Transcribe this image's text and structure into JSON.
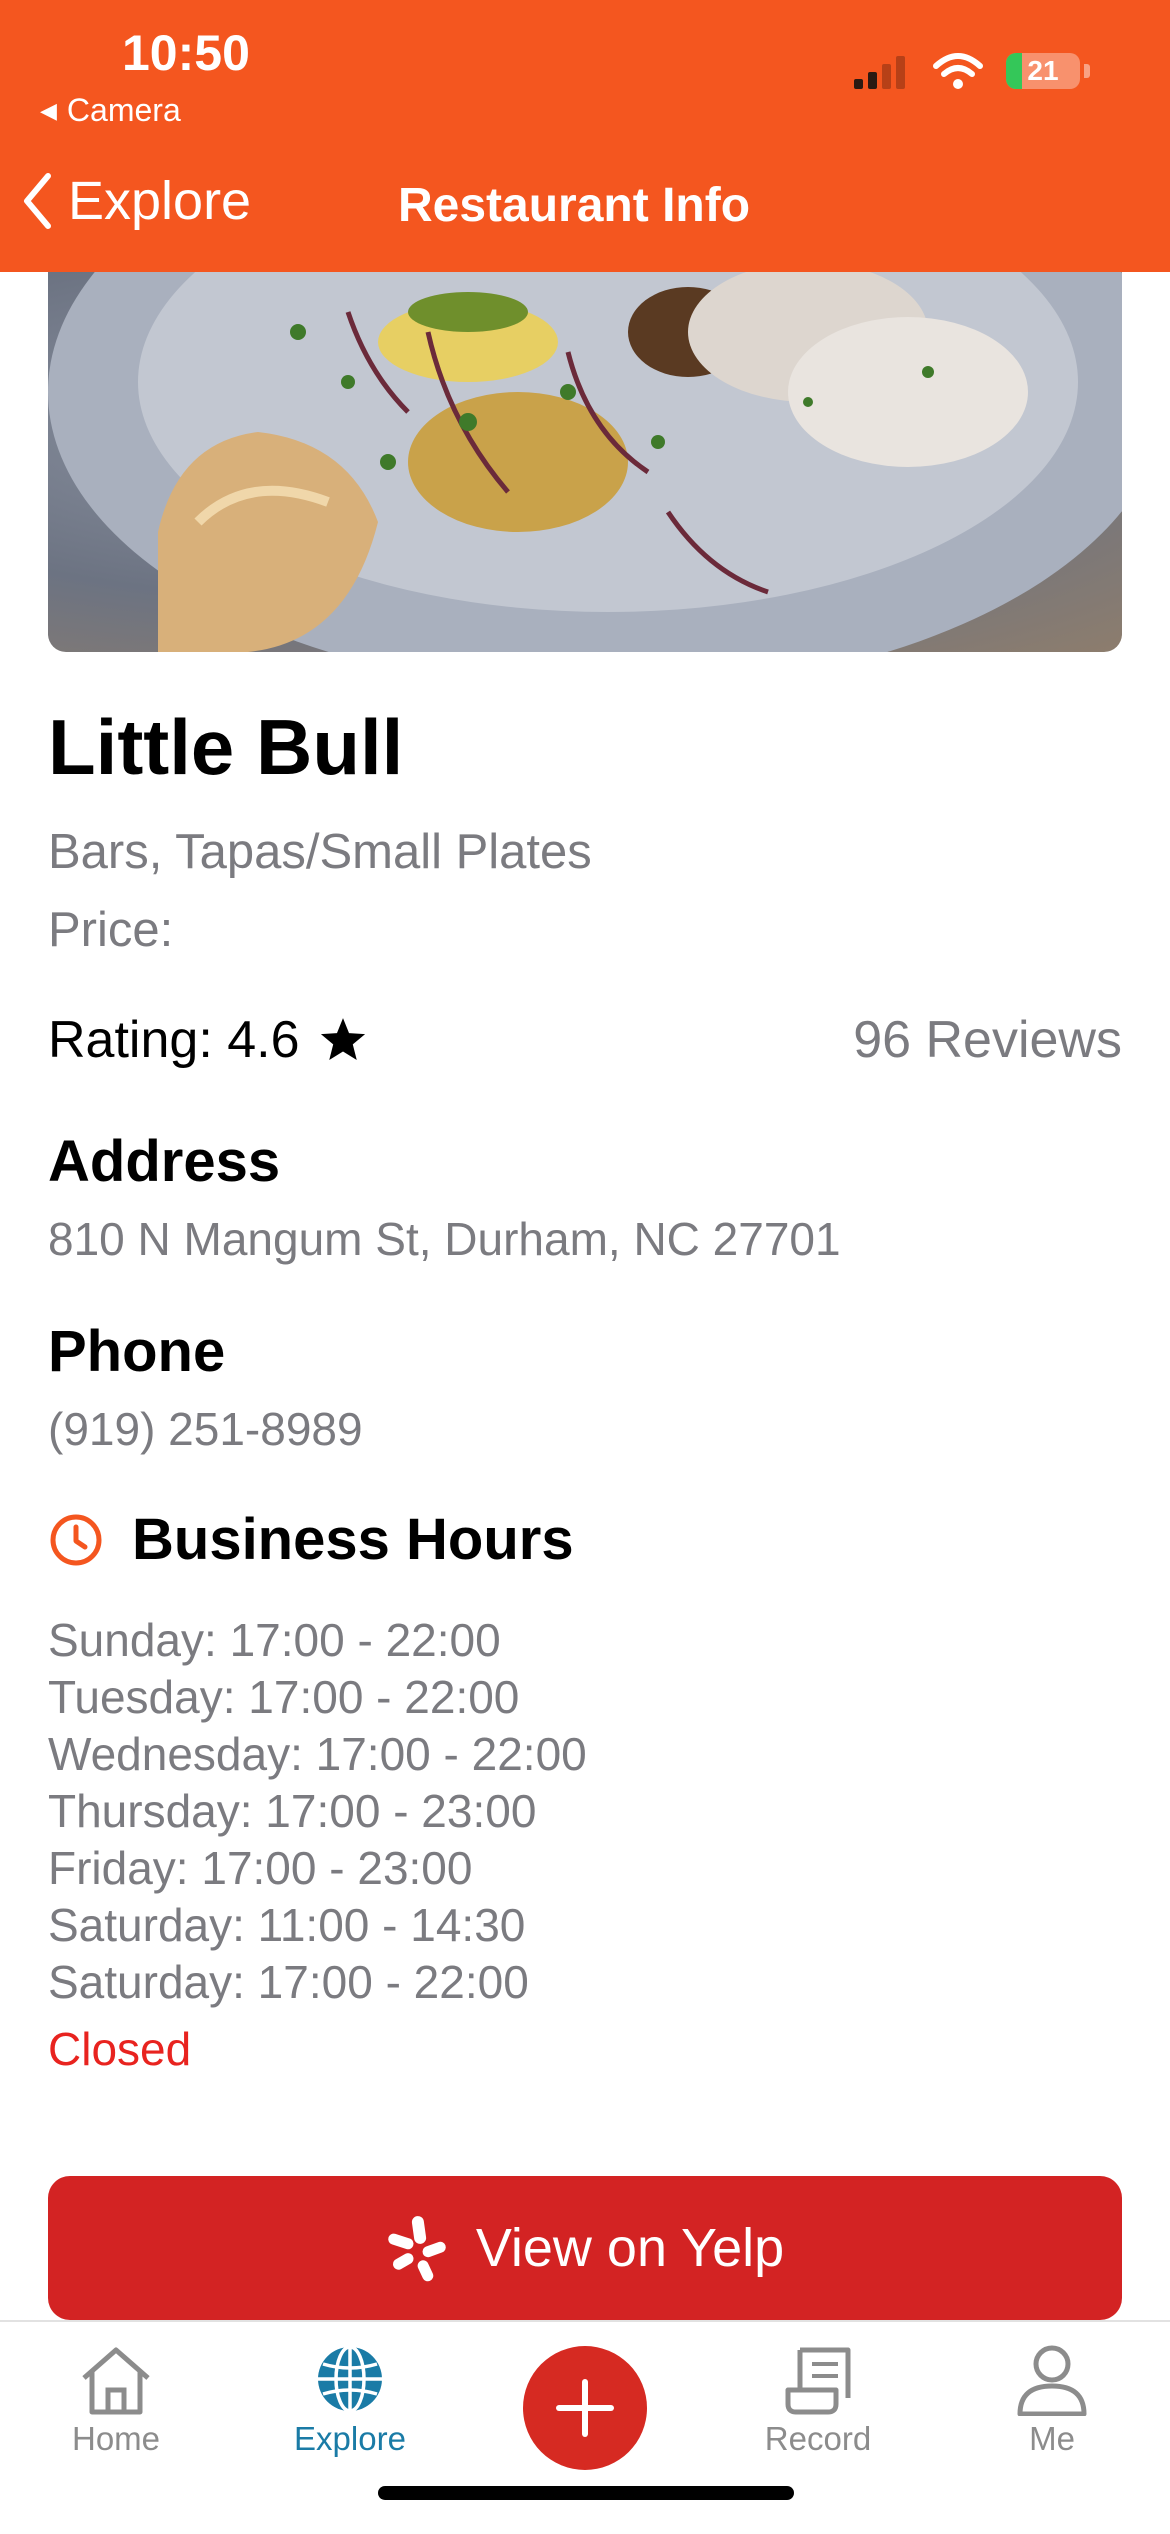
{
  "status_bar": {
    "time": "10:50",
    "back_app": "Camera",
    "battery": "21",
    "battery_level": 0.21
  },
  "nav": {
    "back_label": "Explore",
    "title": "Restaurant Info"
  },
  "restaurant": {
    "name": "Little Bull",
    "categories": "Bars, Tapas/Small Plates",
    "price_label": "Price:",
    "rating_label": "Rating: 4.6",
    "reviews": "96 Reviews"
  },
  "address": {
    "title": "Address",
    "value": "810 N Mangum St, Durham, NC 27701"
  },
  "phone": {
    "title": "Phone",
    "value": "(919) 251-8989"
  },
  "hours": {
    "title": "Business Hours",
    "lines": [
      "Sunday: 17:00 - 22:00",
      "Tuesday: 17:00 - 22:00",
      "Wednesday: 17:00 - 22:00",
      "Thursday: 17:00 - 23:00",
      "Friday: 17:00 - 23:00",
      "Saturday: 11:00 - 14:30",
      "Saturday: 17:00 - 22:00"
    ],
    "status": "Closed"
  },
  "yelp_button": {
    "label": "View on Yelp"
  },
  "tabs": [
    {
      "label": "Home",
      "icon": "house-icon"
    },
    {
      "label": "Explore",
      "icon": "globe-icon"
    },
    {
      "label": "",
      "icon": "plus-icon"
    },
    {
      "label": "Record",
      "icon": "receipt-icon"
    },
    {
      "label": "Me",
      "icon": "person-icon"
    }
  ],
  "colors": {
    "header": "#f4561f",
    "yelp_red": "#d32323",
    "closed_red": "#e8231f",
    "tab_active": "#1a7ba6",
    "secondary_text": "#7b7b80"
  }
}
